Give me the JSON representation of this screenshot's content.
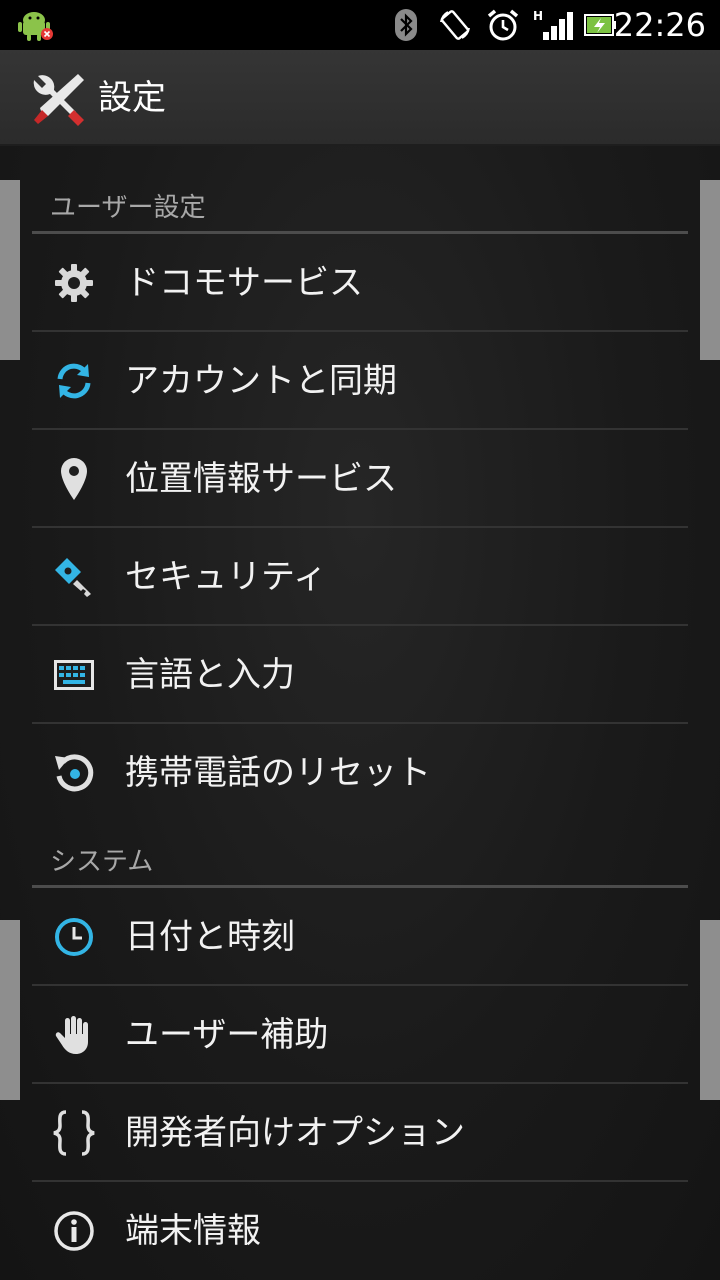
{
  "status_bar": {
    "time": "22:26",
    "icons": [
      "android-debug-icon",
      "bluetooth-icon",
      "auto-rotate-icon",
      "alarm-icon",
      "signal-h-icon",
      "battery-charging-icon"
    ],
    "network_type": "H"
  },
  "action_bar": {
    "title": "設定",
    "icon": "tools-icon"
  },
  "sections": [
    {
      "header": "ユーザー設定",
      "items": [
        {
          "label": "ドコモサービス",
          "icon": "gear-icon"
        },
        {
          "label": "アカウントと同期",
          "icon": "sync-icon"
        },
        {
          "label": "位置情報サービス",
          "icon": "location-pin-icon"
        },
        {
          "label": "セキュリティ",
          "icon": "key-icon"
        },
        {
          "label": "言語と入力",
          "icon": "keyboard-icon"
        },
        {
          "label": "携帯電話のリセット",
          "icon": "reset-icon"
        }
      ]
    },
    {
      "header": "システム",
      "items": [
        {
          "label": "日付と時刻",
          "icon": "clock-icon"
        },
        {
          "label": "ユーザー補助",
          "icon": "hand-icon"
        },
        {
          "label": "開発者向けオプション",
          "icon": "braces-icon"
        },
        {
          "label": "端末情報",
          "icon": "info-icon"
        }
      ]
    }
  ],
  "colors": {
    "accent": "#33b5e5",
    "background": "#1a1a1a",
    "divider": "#333333"
  }
}
